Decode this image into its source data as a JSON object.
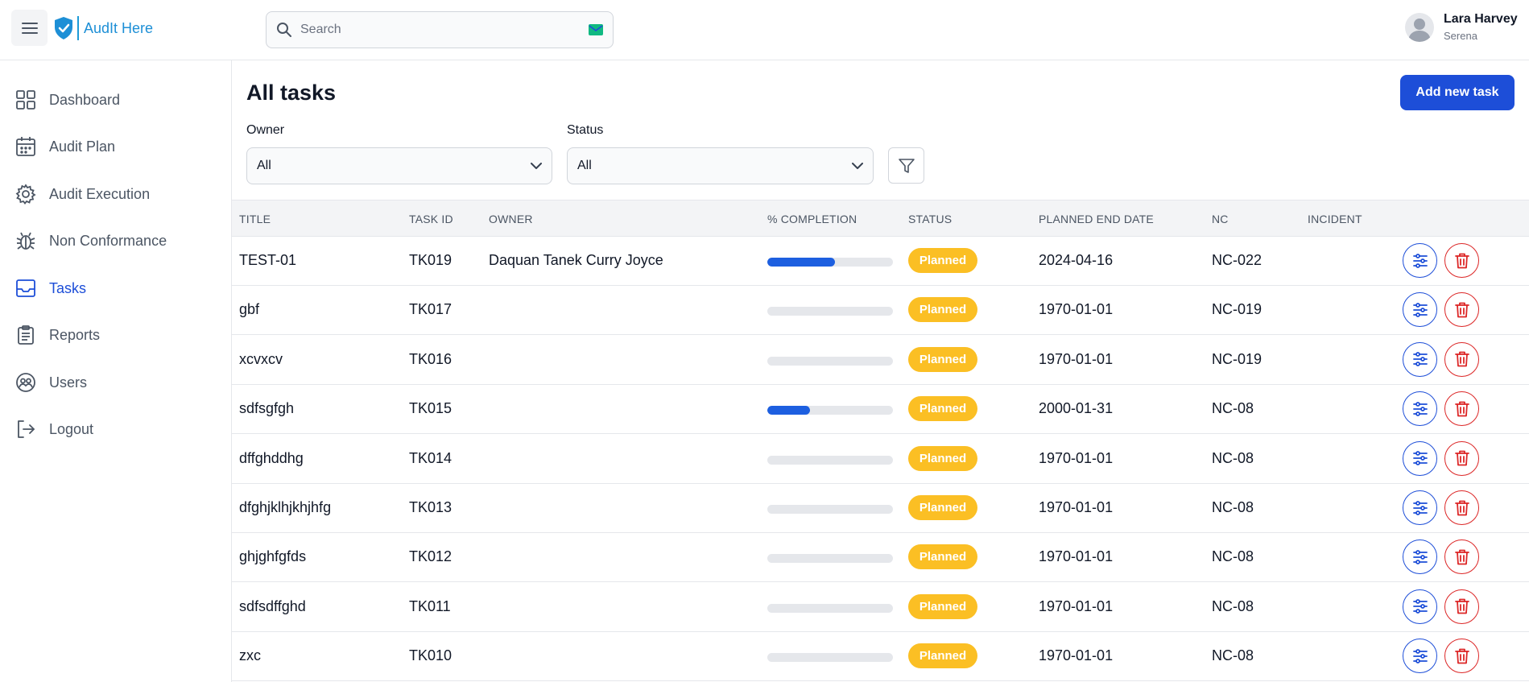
{
  "app": {
    "logo_text": "AudIt Here"
  },
  "search": {
    "placeholder": "Search"
  },
  "user": {
    "name": "Lara Harvey",
    "subtitle": "Serena"
  },
  "sidebar": {
    "items": [
      {
        "label": "Dashboard",
        "icon": "grid-icon",
        "active": false
      },
      {
        "label": "Audit Plan",
        "icon": "calendar-icon",
        "active": false
      },
      {
        "label": "Audit Execution",
        "icon": "gear-icon",
        "active": false
      },
      {
        "label": "Non Conformance",
        "icon": "bug-icon",
        "active": false
      },
      {
        "label": "Tasks",
        "icon": "inbox-icon",
        "active": true
      },
      {
        "label": "Reports",
        "icon": "clipboard-icon",
        "active": false
      },
      {
        "label": "Users",
        "icon": "users-icon",
        "active": false
      },
      {
        "label": "Logout",
        "icon": "logout-icon",
        "active": false
      }
    ]
  },
  "main": {
    "title": "All tasks",
    "add_button": "Add new task",
    "filters": {
      "owner_label": "Owner",
      "owner_value": "All",
      "status_label": "Status",
      "status_value": "All"
    }
  },
  "table": {
    "headers": [
      "TITLE",
      "TASK ID",
      "OWNER",
      "% COMPLETION",
      "STATUS",
      "PLANNED END DATE",
      "NC",
      "INCIDENT"
    ],
    "rows": [
      {
        "title": "TEST-01",
        "task_id": "TK019",
        "owner": "Daquan Tanek Curry Joyce",
        "completion": 0.54,
        "status": "Planned",
        "end_date": "2024-04-16",
        "nc": "NC-022",
        "incident": ""
      },
      {
        "title": "gbf",
        "task_id": "TK017",
        "owner": "",
        "completion": 0,
        "status": "Planned",
        "end_date": "1970-01-01",
        "nc": "NC-019",
        "incident": ""
      },
      {
        "title": "xcvxcv",
        "task_id": "TK016",
        "owner": "",
        "completion": 0,
        "status": "Planned",
        "end_date": "1970-01-01",
        "nc": "NC-019",
        "incident": ""
      },
      {
        "title": "sdfsgfgh",
        "task_id": "TK015",
        "owner": "",
        "completion": 0.34,
        "status": "Planned",
        "end_date": "2000-01-31",
        "nc": "NC-08",
        "incident": ""
      },
      {
        "title": "dffghddhg",
        "task_id": "TK014",
        "owner": "",
        "completion": 0,
        "status": "Planned",
        "end_date": "1970-01-01",
        "nc": "NC-08",
        "incident": ""
      },
      {
        "title": "dfghjklhjkhjhfg",
        "task_id": "TK013",
        "owner": "",
        "completion": 0,
        "status": "Planned",
        "end_date": "1970-01-01",
        "nc": "NC-08",
        "incident": ""
      },
      {
        "title": "ghjghfgfds",
        "task_id": "TK012",
        "owner": "",
        "completion": 0,
        "status": "Planned",
        "end_date": "1970-01-01",
        "nc": "NC-08",
        "incident": ""
      },
      {
        "title": "sdfsdffghd",
        "task_id": "TK011",
        "owner": "",
        "completion": 0,
        "status": "Planned",
        "end_date": "1970-01-01",
        "nc": "NC-08",
        "incident": ""
      },
      {
        "title": "zxc",
        "task_id": "TK010",
        "owner": "",
        "completion": 0,
        "status": "Planned",
        "end_date": "1970-01-01",
        "nc": "NC-08",
        "incident": ""
      }
    ]
  },
  "colors": {
    "accent": "#1d4ed8",
    "status_planned": "#fbbf24",
    "danger": "#dc2626",
    "progress_fill": "#1d5fe0"
  }
}
